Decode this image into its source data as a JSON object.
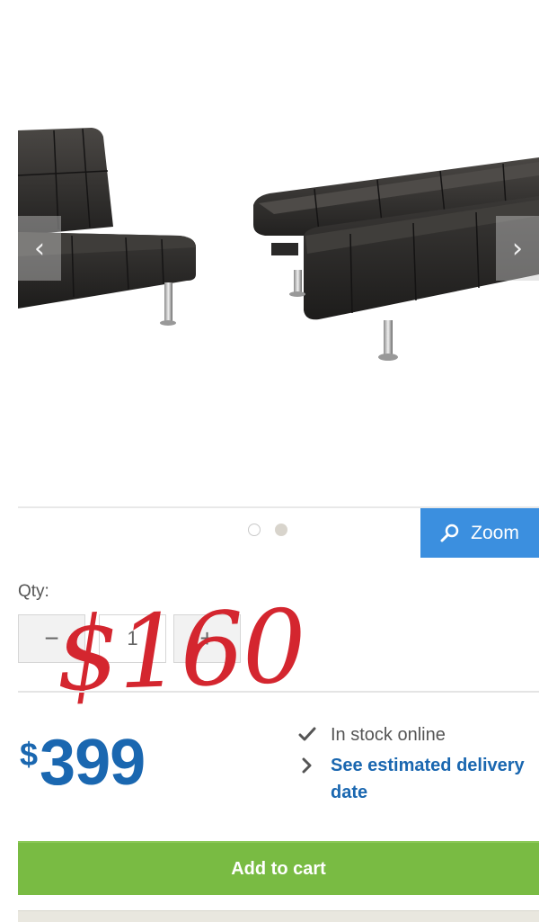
{
  "gallery": {
    "prev_icon": "chevron-left-icon",
    "next_icon": "chevron-right-icon",
    "image_alt": "Black faux-leather click-clack futon shown sitting and as a flat bed",
    "dots_count": 2,
    "active_dot": 2
  },
  "zoom": {
    "label": "Zoom",
    "icon": "search-icon"
  },
  "quantity": {
    "label": "Qty:",
    "value": "1",
    "minus_label": "−",
    "plus_label": "+"
  },
  "overlay": {
    "handwritten_price": "$160",
    "color": "#d4262f"
  },
  "price": {
    "currency": "$",
    "amount": "399",
    "color": "#1a67b0"
  },
  "availability": {
    "stock_text": "In stock online",
    "stock_icon": "checkmark-icon",
    "delivery_text": "See estimated delivery date",
    "delivery_icon": "chevron-right-icon"
  },
  "cart": {
    "label": "Add to cart",
    "color": "#79bb43"
  }
}
